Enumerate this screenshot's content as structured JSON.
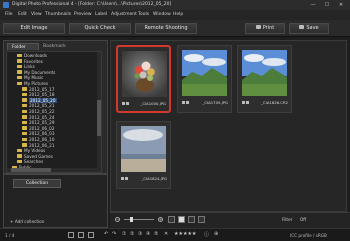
{
  "window": {
    "title": "Digital Photo Professional 4 - [Folder: C:\\Users\\...\\Pictures\\2012_05_20]",
    "controls": [
      "—",
      "☐",
      "✕"
    ]
  },
  "menu": [
    "File",
    "Edit",
    "View",
    "Thumbnails",
    "Preview",
    "Label",
    "Adjustment",
    "Tools",
    "Window",
    "Help"
  ],
  "toolbar": {
    "edit_image": "Edit Image",
    "quick_check": "Quick Check",
    "remote_shooting": "Remote Shooting",
    "print": "Print",
    "save": "Save"
  },
  "left_panel": {
    "tabs": [
      "Folder",
      "Bookmark"
    ],
    "tree": [
      {
        "label": "Downloads",
        "indent": 2
      },
      {
        "label": "Favorites",
        "indent": 2
      },
      {
        "label": "Links",
        "indent": 2
      },
      {
        "label": "My Documents",
        "indent": 2
      },
      {
        "label": "My Music",
        "indent": 2
      },
      {
        "label": "My Pictures",
        "indent": 2
      },
      {
        "label": "2012_05_17",
        "indent": 3
      },
      {
        "label": "2012_05_18",
        "indent": 3
      },
      {
        "label": "2012_05_20",
        "indent": 3,
        "selected": true
      },
      {
        "label": "2012_05_21",
        "indent": 3
      },
      {
        "label": "2012_05_22",
        "indent": 3
      },
      {
        "label": "2012_05_24",
        "indent": 3
      },
      {
        "label": "2012_05_29",
        "indent": 3
      },
      {
        "label": "2012_06_02",
        "indent": 3
      },
      {
        "label": "2012_06_03",
        "indent": 3
      },
      {
        "label": "2012_06_10",
        "indent": 3
      },
      {
        "label": "2012_06_21",
        "indent": 3
      },
      {
        "label": "My Videos",
        "indent": 2
      },
      {
        "label": "Saved Games",
        "indent": 2
      },
      {
        "label": "Searches",
        "indent": 2
      },
      {
        "label": "Public",
        "indent": 1
      }
    ]
  },
  "collection": {
    "tab_label": "Collection",
    "add_label": "+ Add collection"
  },
  "thumbnails": [
    {
      "name": "_CIA1000.JPG",
      "selected": true,
      "kind": "flowers"
    },
    {
      "name": "_CIA1705.JPG",
      "selected": false,
      "kind": "landscape"
    },
    {
      "name": "_CIA1826.CR2",
      "selected": false,
      "kind": "landscape"
    },
    {
      "name": "_CIA1824.JPG",
      "selected": false,
      "kind": "beach"
    }
  ],
  "bottom_bar": {
    "filter_label": "Filter",
    "filter_value": "Off"
  },
  "status_bar": {
    "count": "1 / 4",
    "right_text": "ICC profile / sRGB"
  },
  "colors": {
    "selection_border": "#d0392b",
    "tree_selected": "#2f4f7a",
    "folder": "#d6b64a"
  }
}
